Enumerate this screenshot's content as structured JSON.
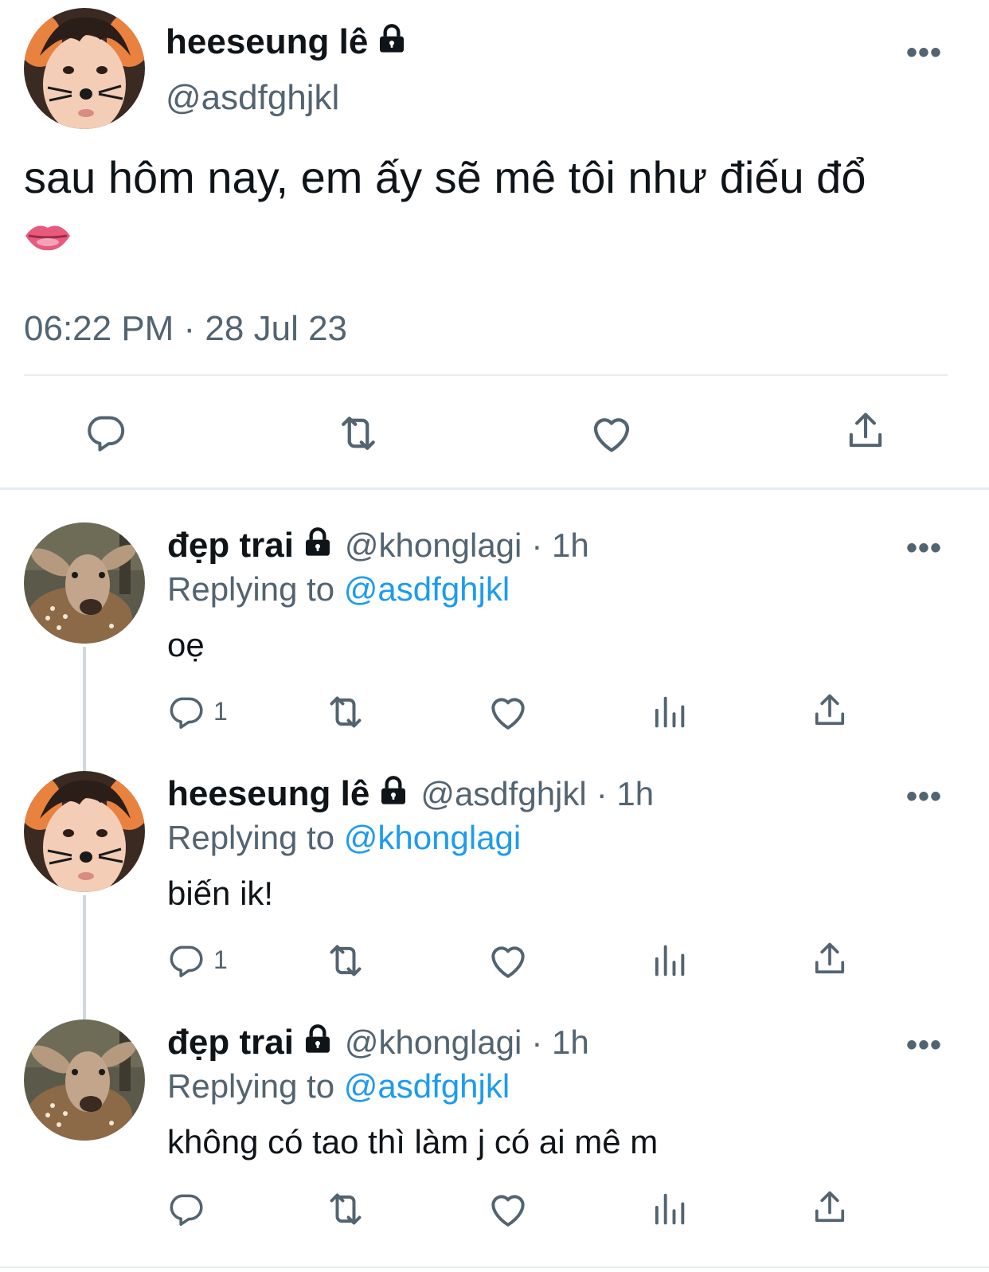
{
  "main_tweet": {
    "name": "heeseung lê",
    "handle": "@asdfghjkl",
    "text_line1": "sau hôm nay, em ấy sẽ mê tôi như điếu đổ",
    "emoji": "👄",
    "timestamp": "06:22 PM · 28 Jul 23",
    "more": "•••"
  },
  "replies": [
    {
      "name": "đẹp trai",
      "handle": "@khonglagi",
      "time": "· 1h",
      "replying_prefix": "Replying to",
      "replying_to": "@asdfghjkl",
      "text": "oẹ",
      "reply_count": "1",
      "more": "•••"
    },
    {
      "name": "heeseung lê",
      "handle": "@asdfghjkl",
      "time": "· 1h",
      "replying_prefix": "Replying to",
      "replying_to": "@khonglagi",
      "text": "biến ik!",
      "reply_count": "1",
      "more": "•••"
    },
    {
      "name": "đẹp trai",
      "handle": "@khonglagi",
      "time": "· 1h",
      "replying_prefix": "Replying to",
      "replying_to": "@asdfghjkl",
      "text": "không có tao thì làm j có ai mê m",
      "reply_count": "",
      "more": "•••"
    }
  ],
  "icons": [
    "reply-icon",
    "retweet-icon",
    "like-icon",
    "views-icon",
    "share-icon",
    "lock-icon",
    "more-icon"
  ],
  "colors": {
    "text": "#0f1419",
    "secondary": "#536471",
    "link": "#1d9bf0",
    "divider": "#e6ecf0"
  }
}
